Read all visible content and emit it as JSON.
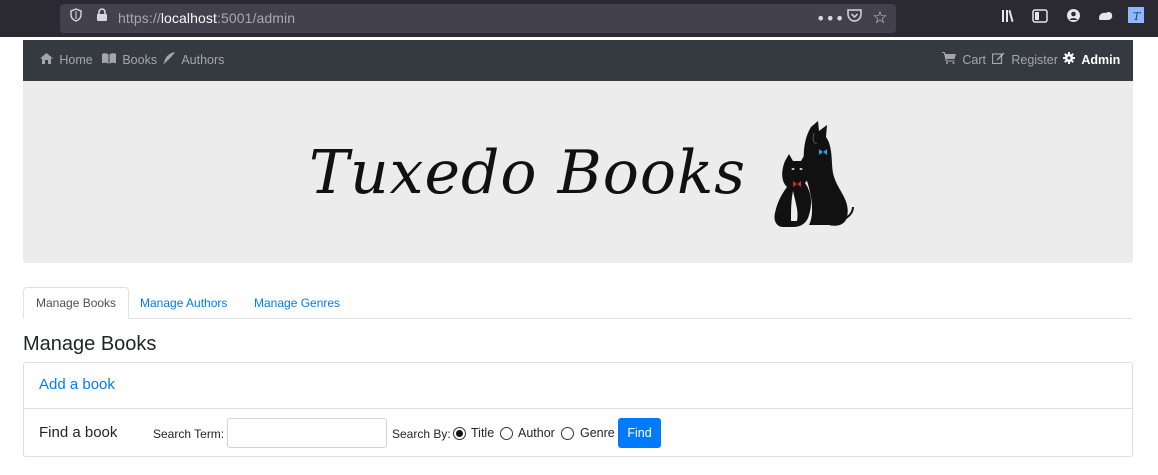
{
  "browser": {
    "url_prefix": "https://",
    "url_host": "localhost",
    "url_rest": ":5001/admin",
    "icons": [
      "shield-icon",
      "lock-icon",
      "more-icon",
      "pocket-icon",
      "star-icon",
      "library-icon",
      "sidebar-icon",
      "account-icon",
      "extension-icon",
      "tab-icon"
    ]
  },
  "nav": {
    "left": [
      {
        "label": "Home",
        "icon": "home-icon"
      },
      {
        "label": "Books",
        "icon": "book-icon"
      },
      {
        "label": "Authors",
        "icon": "feather-icon"
      }
    ],
    "right": [
      {
        "label": "Cart",
        "icon": "cart-icon"
      },
      {
        "label": "Register",
        "icon": "edit-icon"
      },
      {
        "label": "Admin",
        "icon": "gear-icon"
      }
    ]
  },
  "banner": {
    "logo_text": "Tuxedo Books"
  },
  "tabs": [
    {
      "label": "Manage Books",
      "active": true
    },
    {
      "label": "Manage Authors",
      "active": false
    },
    {
      "label": "Manage Genres",
      "active": false
    }
  ],
  "page_title": "Manage Books",
  "panel": {
    "add_link": "Add a book",
    "find_label": "Find a book",
    "search_term_label": "Search Term:",
    "search_value": "",
    "search_by_label": "Search By:",
    "options": [
      {
        "label": "Title",
        "checked": true
      },
      {
        "label": "Author",
        "checked": false
      },
      {
        "label": "Genre",
        "checked": false
      }
    ],
    "find_button": "Find"
  },
  "colors": {
    "navbar": "#343a40",
    "link": "#007bff",
    "banner_bg": "#ececec",
    "chrome": "#2b2a33"
  }
}
